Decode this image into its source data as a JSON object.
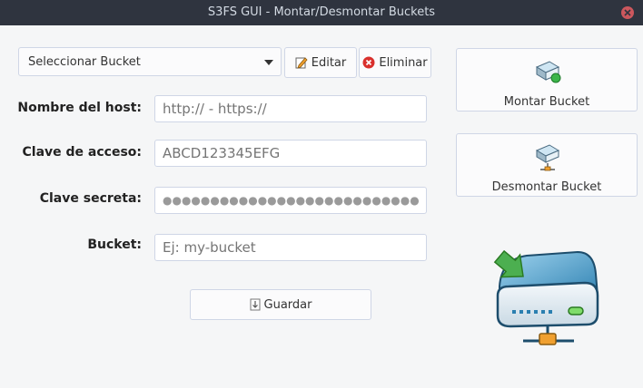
{
  "window": {
    "title": "S3FS GUI - Montar/Desmontar Buckets"
  },
  "bucket_select": {
    "selected": "Seleccionar Bucket"
  },
  "toolbar": {
    "edit_label": "Editar",
    "delete_label": "Eliminar"
  },
  "form": {
    "host_label": "Nombre del host:",
    "host_placeholder": "http:// - https://",
    "access_label": "Clave de acceso:",
    "access_placeholder": "ABCD123345EFG",
    "secret_label": "Clave secreta:",
    "secret_value": "●●●●●●●●●●●●●●●●●●●●●●●●●●●●",
    "bucket_label": "Bucket:",
    "bucket_placeholder": "Ej: my-bucket",
    "save_label": "Guardar"
  },
  "actions": {
    "mount_label": "Montar Bucket",
    "unmount_label": "Desmontar Bucket"
  },
  "colors": {
    "titlebar": "#2f343f",
    "close": "#cc575d",
    "drive": "#3d8fb8",
    "arrow": "#4caf50",
    "network": "#f0a030"
  }
}
